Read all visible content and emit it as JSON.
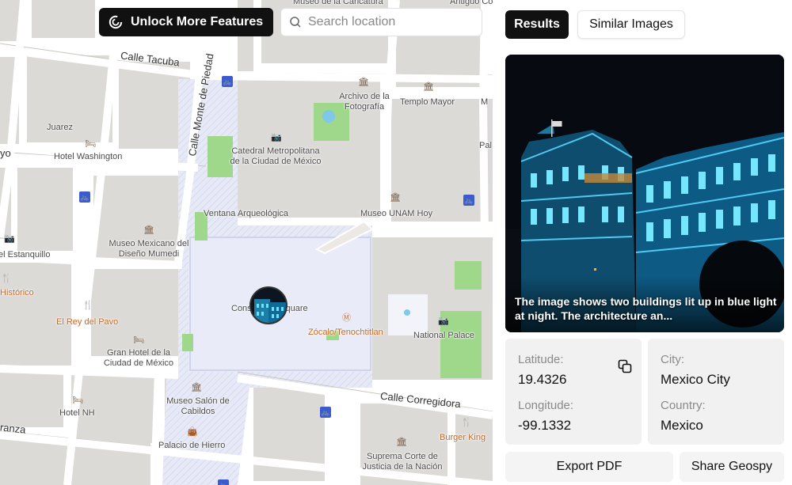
{
  "map": {
    "unlock_label": "Unlock More Features",
    "search_placeholder": "Search location",
    "streets": {
      "tacuba": "Calle Tacuba",
      "monte_piedad": "Calle Monte de Piedad",
      "corregidora": "Calle Corregidora",
      "ranza": "ranza",
      "yo": "yo"
    },
    "places": {
      "museo_caricatura": "Museo de la Caricatura",
      "antiguo_colegio": "Antiguo Cole",
      "archivo_fotografia": "Archivo de la Fotografía",
      "templo_mayor": "Templo Mayor",
      "juarez": "Juarez",
      "hotel_washington": "Hotel Washington",
      "catedral": "Catedral Metropolitana de la Ciudad de México",
      "ventana": "Ventana Arqueológica",
      "museo_unam": "Museo UNAM Hoy",
      "museo_diseno": "Museo Mexicano del Diseño Mumedi",
      "estanquillo": "el Estanquillo",
      "historico": "Histórico",
      "rey_pavo": "El Rey del Pavo",
      "constitucion_square": "Constitution Square",
      "zocalo": "Zócalo/Tenochtitlan",
      "national_palace": "National Palace",
      "gran_hotel": "Gran Hotel de la Ciudad de México",
      "hotel_nh": "Hotel NH",
      "museo_salon": "Museo Salón de Cabildos",
      "palacio_hierro": "Palacio de Hierro",
      "suprema_corte": "Suprema Corte de Justicia de la Nación",
      "burger_king": "Burger King",
      "pal_right": "Pal",
      "m_right": "M"
    }
  },
  "panel": {
    "tabs": [
      "Results",
      "Similar Images"
    ],
    "caption": "The image shows two buildings lit up in blue light at night. The architecture an...",
    "latitude_label": "Latitude:",
    "latitude_value": "19.4326",
    "longitude_label": "Longitude:",
    "longitude_value": "-99.1332",
    "city_label": "City:",
    "city_value": "Mexico City",
    "country_label": "Country:",
    "country_value": "Mexico",
    "export_label": "Export PDF",
    "share_label": "Share Geospy"
  },
  "icons": {
    "logo": "geospy-logo-icon",
    "search": "search-icon",
    "copy": "copy-icon",
    "bike": "bike-station-icon",
    "museum": "museum-icon",
    "hotel": "hotel-icon",
    "camera": "camera-icon",
    "restaurant": "restaurant-icon",
    "metro": "metro-icon",
    "shop": "shop-icon"
  },
  "colors": {
    "dark_button": "#111111",
    "plaza": "#e8ebf7",
    "park": "#9fd88a",
    "water": "#7ec8e8",
    "poi_orange": "#d8782a",
    "bike_blue": "#3b5bcf"
  }
}
